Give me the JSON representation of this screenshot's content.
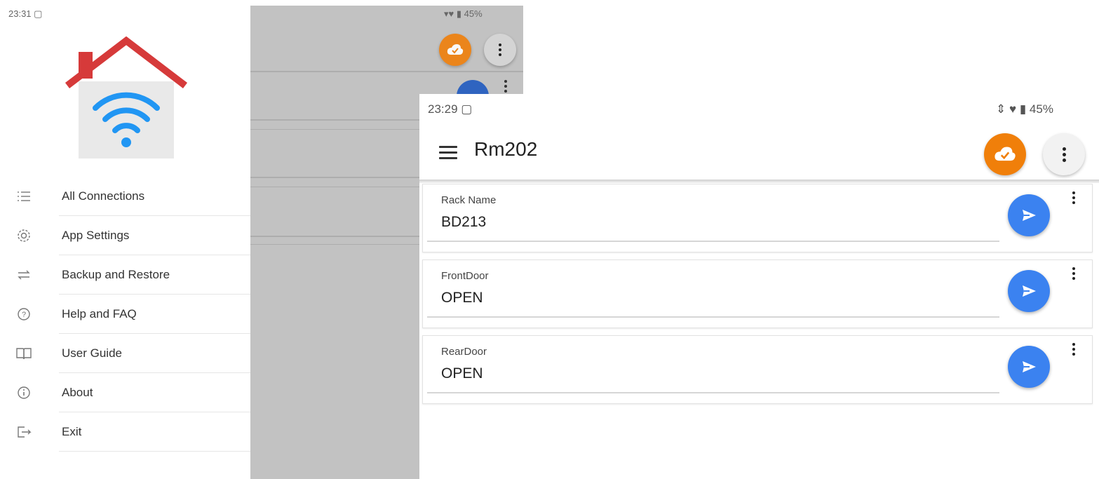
{
  "left": {
    "status_time": "23:31",
    "status_battery": "45%",
    "menu": [
      {
        "label": "All Connections",
        "icon": "list-icon"
      },
      {
        "label": "App Settings",
        "icon": "gear-icon"
      },
      {
        "label": "Backup and Restore",
        "icon": "sync-arrows-icon"
      },
      {
        "label": "Help and FAQ",
        "icon": "help-circle-icon"
      },
      {
        "label": "User Guide",
        "icon": "book-icon"
      },
      {
        "label": "About",
        "icon": "info-circle-icon"
      },
      {
        "label": "Exit",
        "icon": "exit-icon"
      }
    ]
  },
  "right": {
    "status_time": "23:29",
    "status_battery": "45%",
    "title": "Rm202",
    "cards": [
      {
        "label": "Rack Name",
        "value": "BD213"
      },
      {
        "label": "FrontDoor",
        "value": "OPEN"
      },
      {
        "label": "RearDoor",
        "value": "OPEN"
      }
    ]
  },
  "colors": {
    "accent_orange": "#f07f0a",
    "send_blue": "#3b82f0",
    "roof_red": "#d63a3a",
    "wifi_blue": "#2196f3",
    "scrim_grey": "#c2c2c2"
  }
}
